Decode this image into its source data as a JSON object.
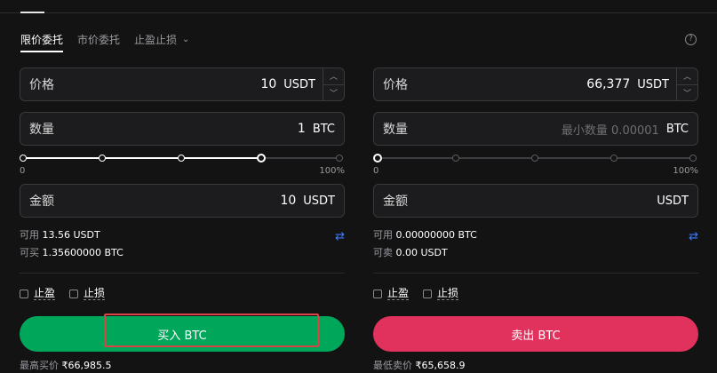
{
  "tabs": {
    "limit": "限价委托",
    "market": "市价委托",
    "tpsl": "止盈止损"
  },
  "buy": {
    "price_label": "价格",
    "price_value": "10",
    "price_unit": "USDT",
    "qty_label": "数量",
    "qty_value": "1",
    "qty_unit": "BTC",
    "slider_min": "0",
    "slider_max": "100%",
    "slider_percent": 75,
    "amount_label": "金额",
    "amount_value": "10",
    "amount_unit": "USDT",
    "available_label": "可用",
    "available_value": "13.56 USDT",
    "canbuy_label": "可买",
    "canbuy_value": "1.35600000 BTC",
    "take_profit": "止盈",
    "stop_loss": "止损",
    "button_label": "买入 BTC",
    "best_label": "最高买价",
    "best_value": "₹66,985.5",
    "color": "#00a65a"
  },
  "sell": {
    "price_label": "价格",
    "price_value": "66,377",
    "price_unit": "USDT",
    "qty_label": "数量",
    "qty_placeholder": "最小数量 0.00001",
    "qty_unit": "BTC",
    "slider_min": "0",
    "slider_max": "100%",
    "slider_percent": 0,
    "amount_label": "金额",
    "amount_unit": "USDT",
    "available_label": "可用",
    "available_value": "0.00000000 BTC",
    "cansell_label": "可卖",
    "cansell_value": "0.00 USDT",
    "take_profit": "止盈",
    "stop_loss": "止损",
    "button_label": "卖出 BTC",
    "best_label": "最低卖价",
    "best_value": "₹65,658.9",
    "color": "#e0325d"
  },
  "icons": {
    "help": "help-icon",
    "swap": "swap-icon",
    "stepper_up": "chevron-up-icon",
    "stepper_down": "chevron-down-icon"
  }
}
